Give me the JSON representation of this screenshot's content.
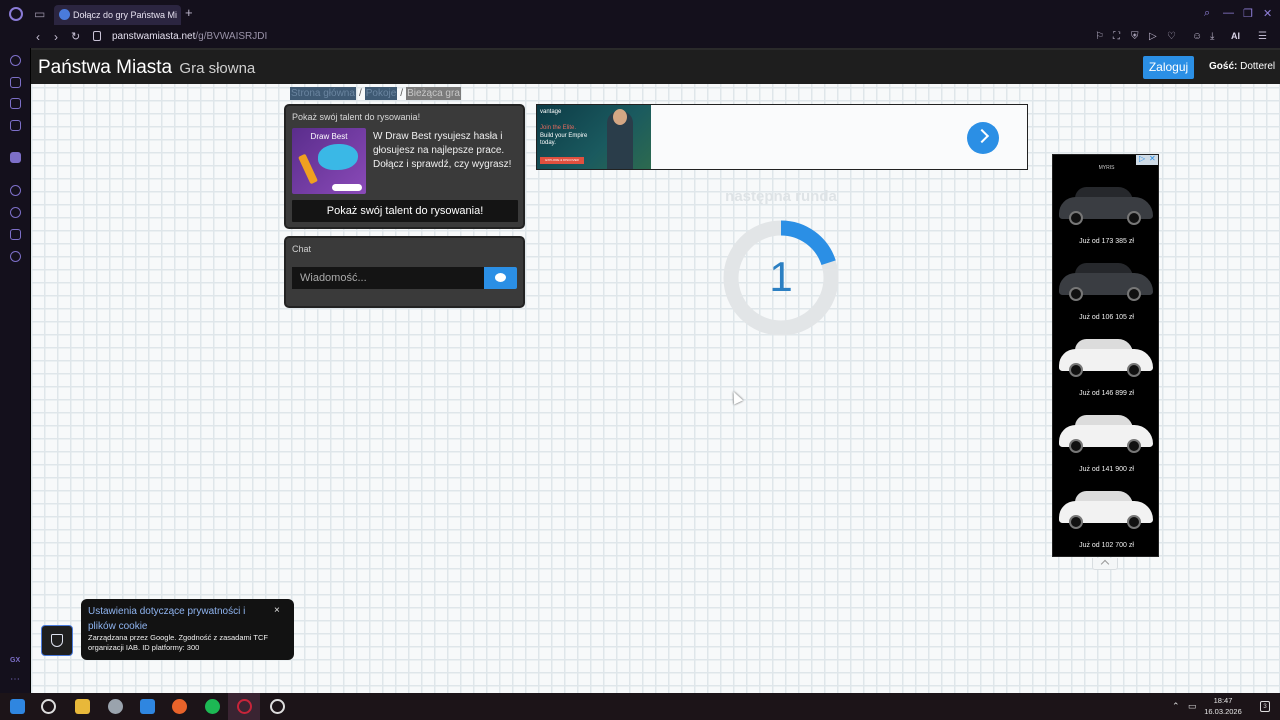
{
  "browser": {
    "tab_title": "Dołącz do gry Państwa Mi",
    "tab_new": "+",
    "url_host": "panstwamiasta.net",
    "url_path": "/g/BVWAISRJDI",
    "ai_label": "AI"
  },
  "header": {
    "title": "Państwa Miasta",
    "subtitle": "Gra słowna",
    "login_label": "Zaloguj",
    "guest_prefix": "Gość:",
    "guest_name": "Dotterel"
  },
  "breadcrumb": {
    "items": [
      "Strona główna",
      "Pokoje",
      "Bieżąca gra"
    ],
    "separator": "/"
  },
  "promo": {
    "title": "Pokaż swój talent do rysowania!",
    "image_title": "Draw Best",
    "text": "W Draw Best rysujesz hasła i głosujesz na najlepsze prace. Dołącz i sprawdź, czy wygrasz!",
    "button": "Pokaż swój talent do rysowania!"
  },
  "chat": {
    "title": "Chat",
    "placeholder": "Wiadomość..."
  },
  "banner_ad": {
    "brand": "vantage",
    "line1": "Join the Elite.",
    "line2": "Build your Empire today.",
    "cta": "EXPLORE & DISCOVER"
  },
  "game": {
    "next_round_label": "następna runda",
    "countdown": "1",
    "progress_fraction": 0.2
  },
  "sky_ad": {
    "brand": "MYRIS",
    "cars": [
      {
        "price": "Już od 173 385 zł",
        "color": "dark"
      },
      {
        "price": "Już od 106 105 zł",
        "color": "dark"
      },
      {
        "price": "Już od 146 899 zł",
        "color": "white"
      },
      {
        "price": "Już od 141 900 zł",
        "color": "white"
      },
      {
        "price": "Już od 102 700 zł",
        "color": "white"
      }
    ]
  },
  "privacy": {
    "title": "Ustawienia dotyczące prywatności i plików cookie",
    "close": "×",
    "text": "Zarządzana przez Google. Zgodność z zasadami TCF organizacji IAB. ID platformy: 300"
  },
  "taskbar": {
    "time": "18:47",
    "date": "16.03.2026",
    "notifications": "3"
  },
  "colors": {
    "accent": "#2b8fe5",
    "countdown_blue": "#2b7fc2",
    "header_bg": "#1e1e1e",
    "card_bg": "#3a3a3a"
  }
}
